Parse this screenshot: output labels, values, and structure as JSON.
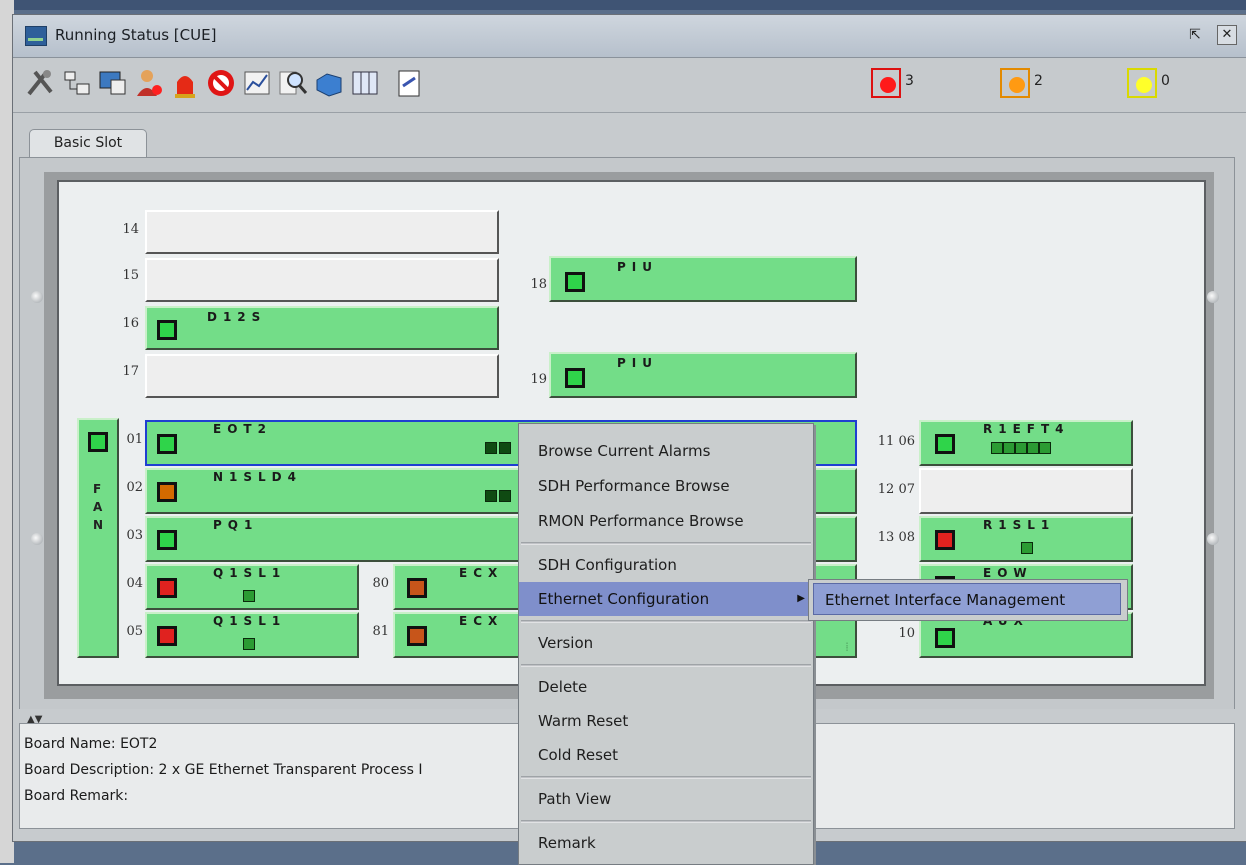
{
  "window": {
    "title": "Running Status [CUE]",
    "restore_icon": "restore-icon",
    "close_icon": "close-icon"
  },
  "toolbar": {
    "icons": [
      "tools-icon",
      "network-icon",
      "monitor-icon",
      "user-alarm-icon",
      "siren-icon",
      "no-alarm-icon",
      "chart-icon",
      "magnify-icon",
      "cube-icon",
      "columns-icon",
      "document-icon"
    ],
    "alarms": [
      {
        "name": "critical",
        "count": "3",
        "color": "#ff1a1a",
        "border": "#d11"
      },
      {
        "name": "major",
        "count": "2",
        "color": "#ff9a12",
        "border": "#e38a00"
      },
      {
        "name": "minor",
        "count": "0",
        "color": "#ffff2a",
        "border": "#d9d900"
      }
    ]
  },
  "tabs": [
    {
      "label": "Basic Slot"
    }
  ],
  "slots": {
    "s14": {
      "num": "14"
    },
    "s15": {
      "num": "15"
    },
    "s16": {
      "num": "16",
      "board": "D12S"
    },
    "s17": {
      "num": "17"
    },
    "s18": {
      "num": "18",
      "board": "PIU"
    },
    "s19": {
      "num": "19",
      "board": "PIU"
    },
    "fan": {
      "label": "FAN"
    },
    "s01": {
      "num": "01",
      "board": "EOT2"
    },
    "s02": {
      "num": "02",
      "board": "N1SLD4"
    },
    "s03": {
      "num": "03",
      "board": "PQ1"
    },
    "s04": {
      "num": "04",
      "board": "Q1SL1"
    },
    "s05": {
      "num": "05",
      "board": "Q1SL1"
    },
    "s80": {
      "num": "80",
      "board": "ECX"
    },
    "s81": {
      "num": "81",
      "board": "ECX"
    },
    "s06": {
      "num": "11 06",
      "board": "R1EFT4"
    },
    "s07": {
      "num": "12 07"
    },
    "s08": {
      "num": "13 08",
      "board": "R1SL1"
    },
    "s09": {
      "board": "EOW"
    },
    "s10": {
      "num": "10",
      "board": "AUX"
    }
  },
  "info": {
    "handle": "▲▼",
    "board_name": "Board Name: EOT2",
    "board_description": "Board Description: 2 x GE Ethernet Transparent Process I",
    "board_remark": "Board Remark:"
  },
  "context_menu": {
    "items": [
      {
        "label": "Browse Current Alarms"
      },
      {
        "label": "SDH Performance Browse"
      },
      {
        "label": "RMON Performance Browse"
      },
      {
        "label": "SDH Configuration"
      },
      {
        "label": "Ethernet Configuration",
        "arrow": "▶"
      },
      {
        "label": "Version"
      },
      {
        "label": "Delete"
      },
      {
        "label": "Warm Reset"
      },
      {
        "label": "Cold Reset"
      },
      {
        "label": "Path View"
      },
      {
        "label": "Remark"
      }
    ],
    "submenu": {
      "label": "Ethernet Interface Management"
    }
  }
}
